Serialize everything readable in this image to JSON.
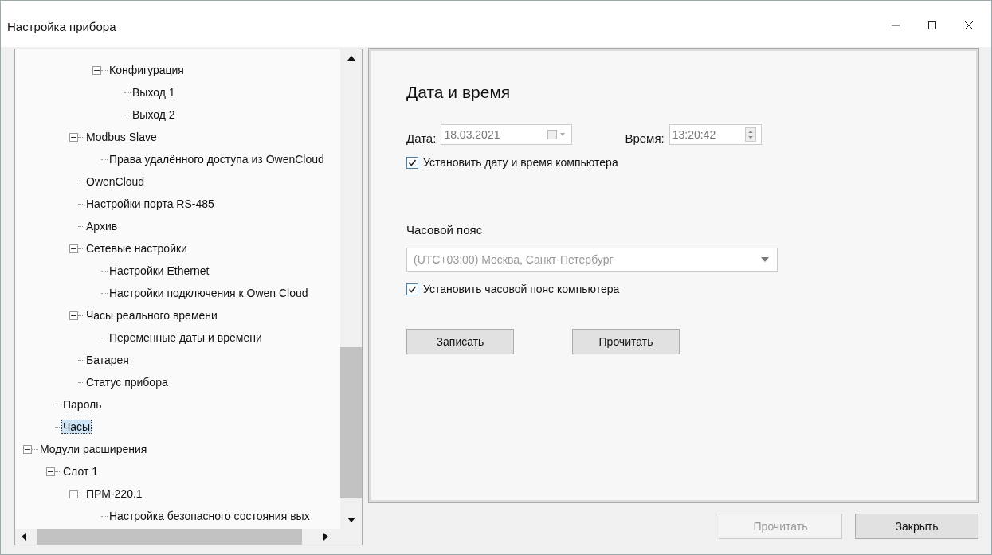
{
  "window": {
    "title": "Настройка прибора"
  },
  "tree": {
    "items": [
      {
        "children": [
          {
            "children": [
              {
                "children": [
                  {
                    "label": "Конфигурация",
                    "selected": false,
                    "expanded": true,
                    "children": [
                      {
                        "label": "Выход 1",
                        "selected": false
                      },
                      {
                        "label": "Выход 2",
                        "selected": false
                      }
                    ]
                  }
                ]
              },
              {
                "label": "Modbus Slave",
                "selected": false,
                "expanded": true,
                "children": [
                  {
                    "label": "Права удалённого доступа из OwenCloud",
                    "selected": false
                  }
                ]
              },
              {
                "label": "OwenCloud",
                "selected": false
              },
              {
                "label": "Настройки порта RS-485",
                "selected": false
              },
              {
                "label": "Архив",
                "selected": false
              },
              {
                "label": "Сетевые настройки",
                "selected": false,
                "expanded": true,
                "children": [
                  {
                    "label": "Настройки Ethernet",
                    "selected": false
                  },
                  {
                    "label": "Настройки подключения к Owen Cloud",
                    "selected": false
                  }
                ]
              },
              {
                "label": "Часы реального времени",
                "selected": false,
                "expanded": true,
                "children": [
                  {
                    "label": "Переменные даты и времени",
                    "selected": false
                  }
                ]
              },
              {
                "label": "Батарея",
                "selected": false
              },
              {
                "label": "Статус прибора",
                "selected": false
              }
            ]
          },
          {
            "label": "Пароль",
            "selected": false
          },
          {
            "label": "Часы",
            "selected": true
          }
        ]
      },
      {
        "label": "Модули расширения",
        "selected": false,
        "expanded": true,
        "children": [
          {
            "label": "Слот 1",
            "selected": false,
            "expanded": true,
            "children": [
              {
                "label": "ПРМ-220.1",
                "selected": false,
                "expanded": true,
                "children": [
                  {
                    "label": "Настройка безопасного состояния вых",
                    "selected": false
                  }
                ]
              }
            ]
          }
        ]
      }
    ]
  },
  "panel": {
    "heading": "Дата и время",
    "date": {
      "label": "Дата:",
      "value": "18.03.2021",
      "disabled": true
    },
    "time": {
      "label": "Время:",
      "value": "13:20:42",
      "disabled": true
    },
    "sync_datetime": {
      "label": "Установить дату и время компьютера",
      "checked": true
    },
    "timezone": {
      "label": "Часовой пояс",
      "value": "(UTC+03:00) Москва, Санкт-Петербург",
      "disabled": true
    },
    "sync_timezone": {
      "label": "Установить часовой пояс компьютера",
      "checked": true
    },
    "buttons": [
      {
        "label": "Записать"
      },
      {
        "label": "Прочитать"
      }
    ]
  },
  "footer_buttons": [
    {
      "label": "Прочитать",
      "disabled": true
    },
    {
      "label": "Закрыть",
      "disabled": false
    }
  ]
}
